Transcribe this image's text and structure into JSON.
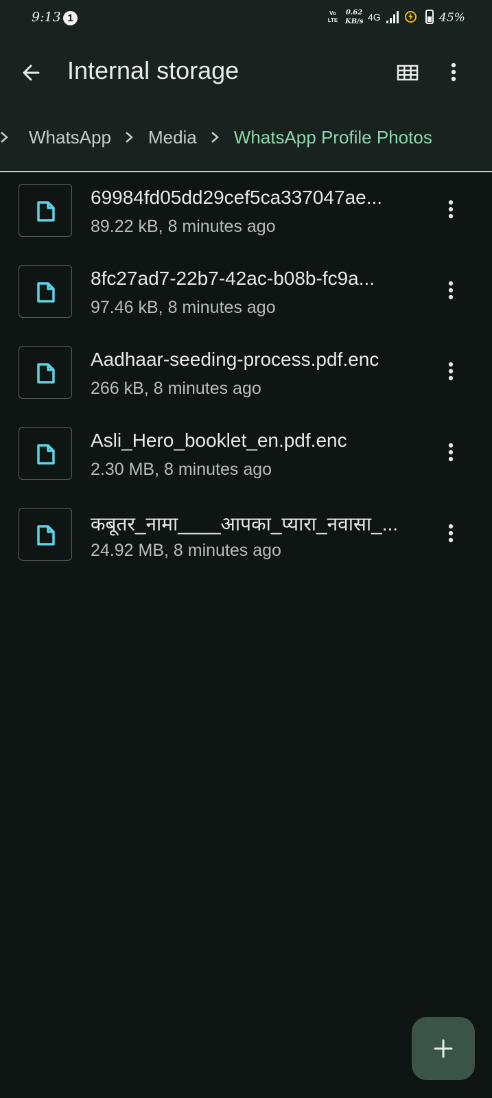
{
  "status_bar": {
    "time": "9:13",
    "notification_count": "1",
    "volte": "Vo\nLTE",
    "speed_value": "0.62",
    "speed_unit": "KB/s",
    "network": "4G",
    "battery_percent": "45%",
    "battery_level": 0.45
  },
  "app_bar": {
    "title": "Internal storage",
    "back_icon": "arrow-back-icon",
    "view_icon": "grid-view-icon",
    "more_icon": "more-vert-icon"
  },
  "breadcrumb": {
    "items": [
      {
        "label": "WhatsApp"
      },
      {
        "label": "Media"
      },
      {
        "label": "WhatsApp Profile Photos",
        "current": true
      }
    ]
  },
  "files": [
    {
      "name": "69984fd05dd29cef5ca337047ae...",
      "meta": "89.22 kB, 8 minutes ago",
      "icon": "file-icon"
    },
    {
      "name": "8fc27ad7-22b7-42ac-b08b-fc9a...",
      "meta": "97.46 kB, 8 minutes ago",
      "icon": "file-icon"
    },
    {
      "name": "Aadhaar-seeding-process.pdf.enc",
      "meta": "266 kB, 8 minutes ago",
      "icon": "file-icon"
    },
    {
      "name": "Asli_Hero_booklet_en.pdf.enc",
      "meta": "2.30 MB, 8 minutes ago",
      "icon": "file-icon"
    },
    {
      "name": "कबूतर_नामा____आपका_प्यारा_नवासा_...",
      "meta": "24.92 MB, 8 minutes ago",
      "icon": "file-icon"
    }
  ],
  "fab": {
    "icon": "plus-icon"
  },
  "colors": {
    "background": "#0e1512",
    "header": "#18231f",
    "accent": "#8fd6b0",
    "file_icon": "#5fd3e8",
    "fab": "#3a5548",
    "battery_bolt": "#f2b600"
  }
}
